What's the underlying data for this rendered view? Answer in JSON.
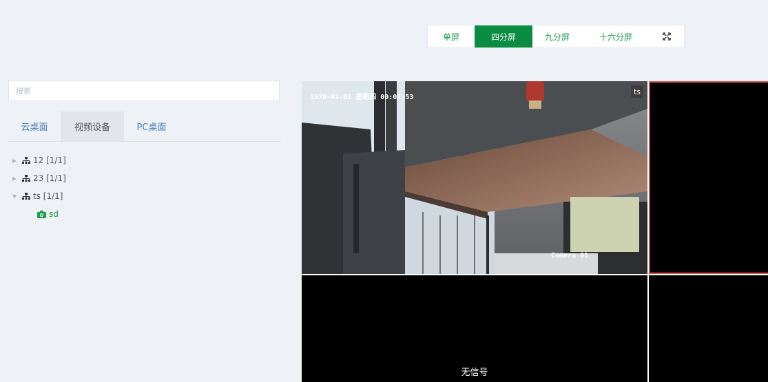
{
  "toolbar": {
    "layouts": [
      {
        "label": "单屏",
        "active": false
      },
      {
        "label": "四分屏",
        "active": true
      },
      {
        "label": "九分屏",
        "active": false
      },
      {
        "label": "十六分屏",
        "active": false
      }
    ],
    "fullscreen_icon": "fullscreen-icon",
    "accent_color": "#0b8c43"
  },
  "search": {
    "placeholder": "搜索"
  },
  "tabs": [
    {
      "label": "云桌面",
      "active": false
    },
    {
      "label": "视频设备",
      "active": true
    },
    {
      "label": "PC桌面",
      "active": false
    }
  ],
  "tree": {
    "nodes": [
      {
        "label": "12 [1/1]",
        "expanded": false
      },
      {
        "label": "23 [1/1]",
        "expanded": false
      },
      {
        "label": "ts [1/1]",
        "expanded": true
      }
    ],
    "child": {
      "label": "sd",
      "icon": "camera-icon"
    }
  },
  "video": {
    "cell1": {
      "timestamp": "1970-01-01 星期四 00:02:53",
      "camera_label": "Camera 01",
      "badge": "ts"
    },
    "cell3": {
      "status": "无信号"
    },
    "selected_border_color": "#d9534f"
  }
}
